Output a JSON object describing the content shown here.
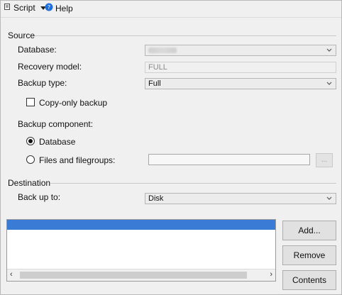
{
  "toolbar": {
    "script_label": "Script",
    "help_label": "Help"
  },
  "source": {
    "title": "Source",
    "database_label": "Database:",
    "database_value": "",
    "recovery_model_label": "Recovery model:",
    "recovery_model_value": "FULL",
    "backup_type_label": "Backup type:",
    "backup_type_value": "Full",
    "copy_only_label": "Copy-only backup",
    "copy_only_checked": false,
    "backup_component_label": "Backup component:",
    "component_database_label": "Database",
    "component_files_label": "Files and filegroups:",
    "selected_component": "Database",
    "files_button_label": "..."
  },
  "destination": {
    "title": "Destination",
    "back_up_to_label": "Back up to:",
    "back_up_to_value": "Disk",
    "add_button": "Add...",
    "remove_button": "Remove",
    "contents_button": "Contents"
  },
  "colors": {
    "selection": "#3a7bd5",
    "window_bg": "#f0f0f0"
  },
  "icons": {
    "script": "script-icon",
    "dropdown": "caret-down-icon",
    "help": "help-icon"
  }
}
